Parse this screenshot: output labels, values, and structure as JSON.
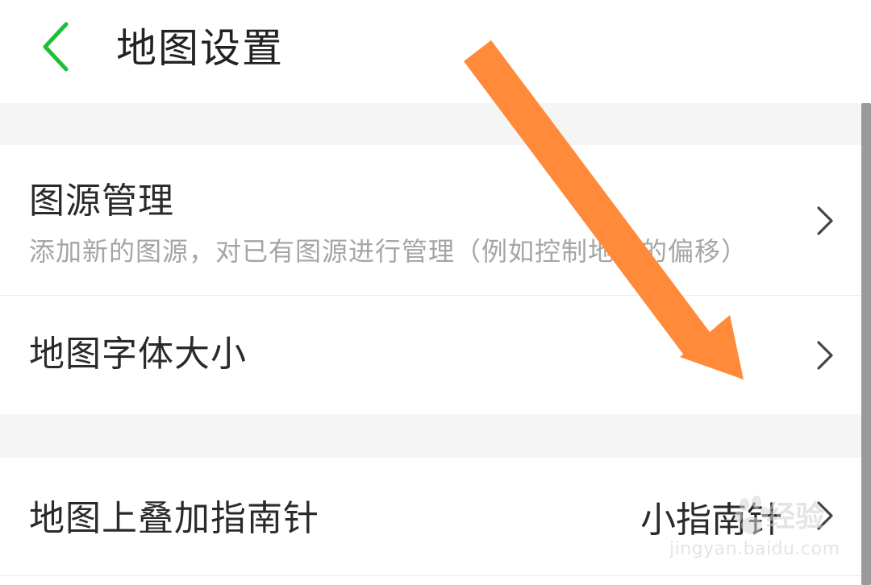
{
  "header": {
    "title": "地图设置",
    "back_icon": "chevron-left-icon",
    "back_color": "#1fbf3a"
  },
  "settings": [
    {
      "title": "图源管理",
      "subtitle": "添加新的图源，对已有图源进行管理（例如控制地图的偏移）",
      "icon": "chevron-right-icon"
    },
    {
      "title": "地图字体大小",
      "icon": "chevron-right-icon"
    },
    {
      "title": "地图上叠加指南针",
      "value": "小指南针",
      "icon": "chevron-right-icon"
    }
  ],
  "overlay": {
    "arrow_color": "#ff8a3a"
  },
  "watermark": {
    "brand": "经验",
    "url": "jingyan.baidu.com"
  }
}
